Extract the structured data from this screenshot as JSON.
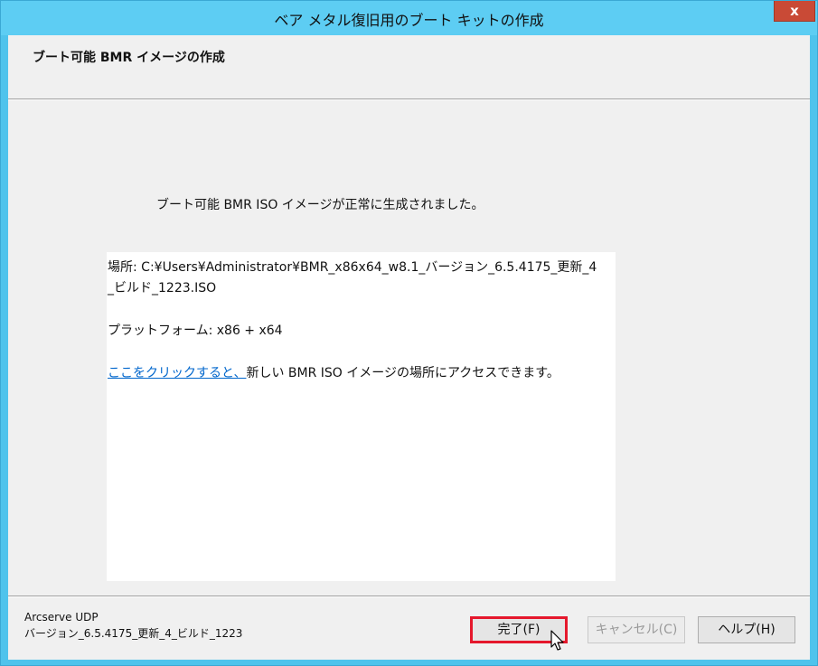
{
  "window": {
    "title": "ベア メタル復旧用のブート キットの作成",
    "close_label": "x"
  },
  "header": {
    "title": "ブート可能 BMR イメージの作成"
  },
  "main": {
    "success_message": "ブート可能 BMR ISO イメージが正常に生成されました。",
    "location_line1": "場所: C:¥Users¥Administrator¥BMR_x86x64_w8.1_バージョン_6.5.4175_更新_4",
    "location_line2": "_ビルド_1223.ISO",
    "platform": "プラットフォーム: x86 + x64",
    "link_text": "ここをクリックすると、",
    "link_suffix": "新しい BMR ISO イメージの場所にアクセスできます。"
  },
  "footer": {
    "product_name": "Arcserve UDP",
    "product_version": "バージョン_6.5.4175_更新_4_ビルド_1223",
    "finish_label": "完了(F)",
    "cancel_label": "キャンセル(C)",
    "help_label": "ヘルプ(H)"
  },
  "colors": {
    "titlebar": "#5dcdf3",
    "close_button": "#c94a36",
    "highlight_border": "#e5182c",
    "link": "#0066cc"
  },
  "icons": {
    "cursor": "mouse-pointer-icon"
  }
}
